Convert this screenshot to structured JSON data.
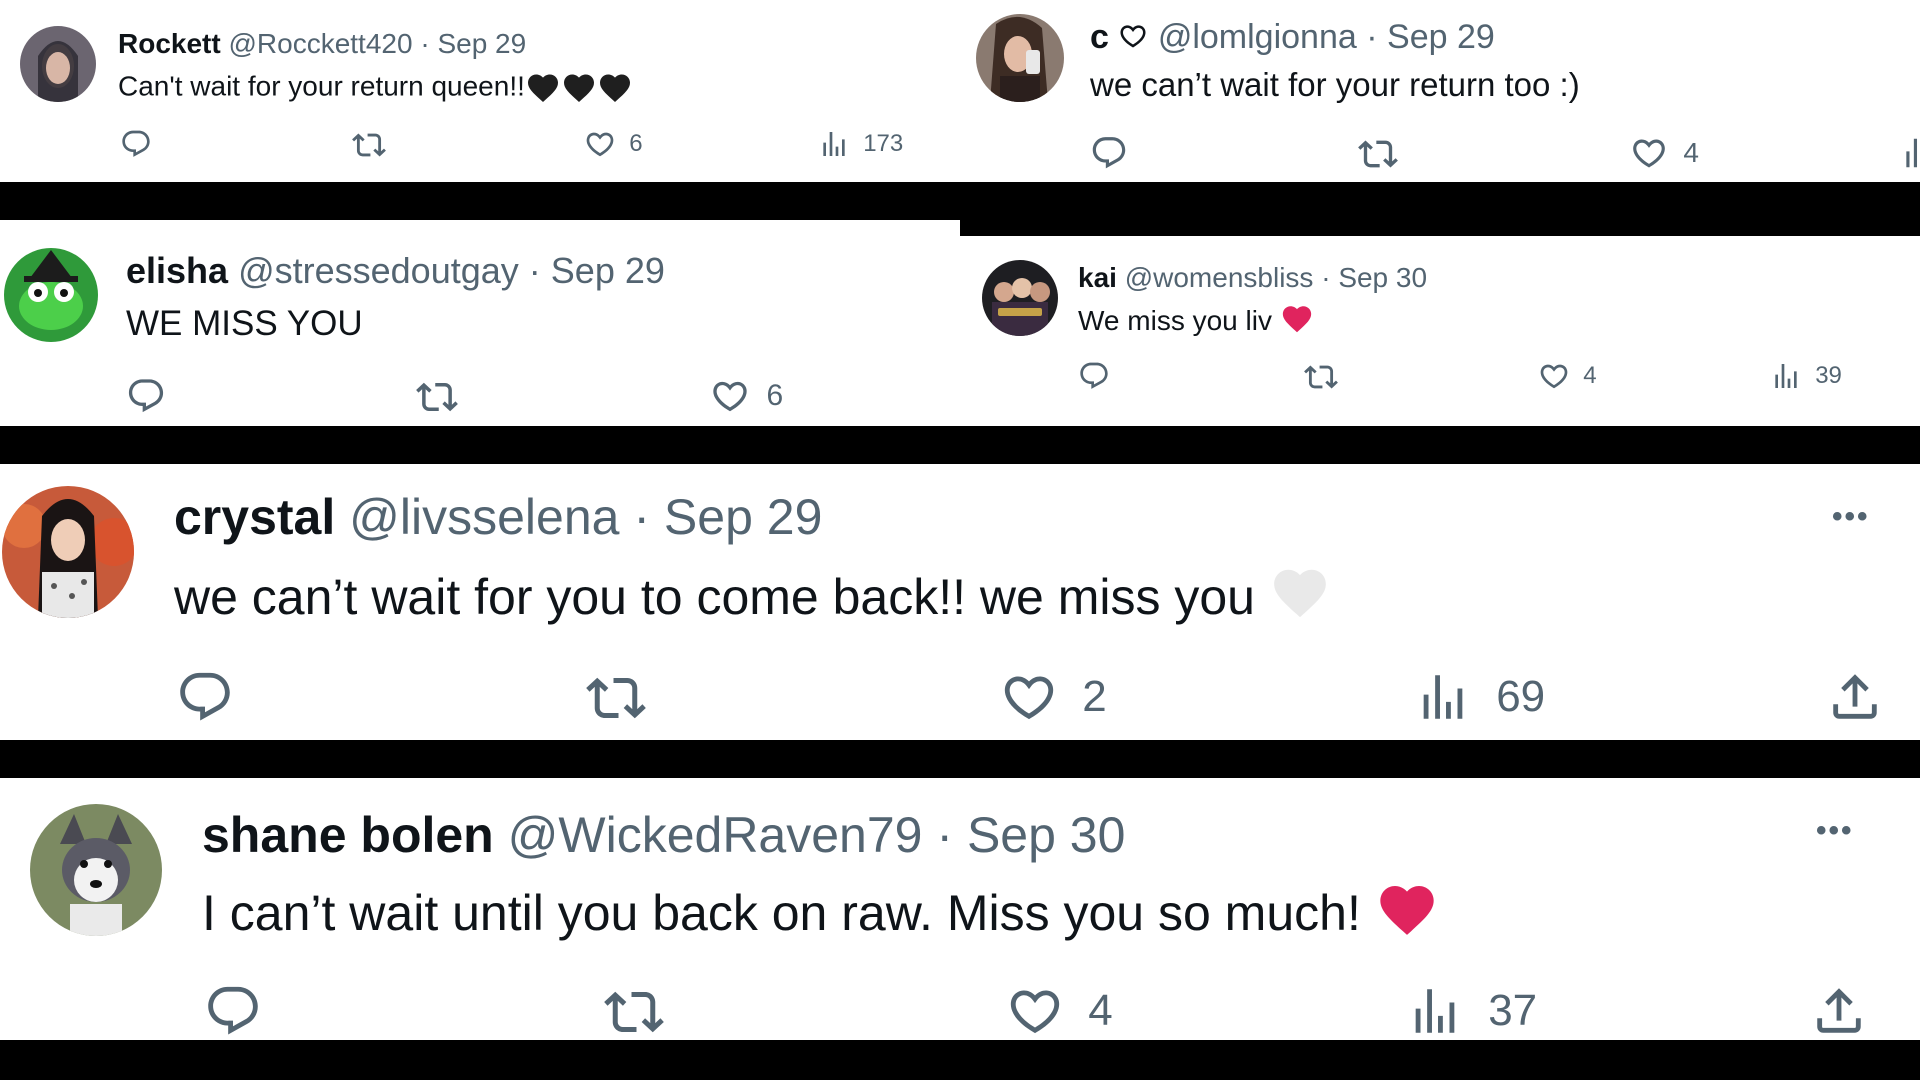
{
  "colors": {
    "divider": "#000000",
    "card_bg": "#ffffff",
    "text_primary": "#0f1419",
    "text_secondary": "#536471",
    "red_heart": "#e0245e",
    "black_heart": "#1f1f1f",
    "white_heart": "#e9e9e9"
  },
  "tweets": [
    {
      "name": "Rockett",
      "handle": "@Rocckett420",
      "sep": "·",
      "date": "Sep 29",
      "text": "Can't wait for your return queen!!",
      "emoji": "black-heart x3",
      "likes": "6",
      "views": "173",
      "avatar_icon": "person-photo-avatar"
    },
    {
      "name": "c",
      "handle": "@lomlgionna",
      "sep": "·",
      "date": "Sep 29",
      "text": "we can’t wait for your return too :)",
      "likes": "4",
      "avatar_icon": "selfie-avatar"
    },
    {
      "name": "elisha",
      "handle": "@stressedoutgay",
      "sep": "·",
      "date": "Sep 29",
      "text": "WE MISS YOU",
      "likes": "6",
      "avatar_icon": "green-frog-witch-avatar"
    },
    {
      "name": "kai",
      "handle": "@womensbliss",
      "sep": "·",
      "date": "Sep 30",
      "text": "We miss you liv",
      "emoji": "red-heart",
      "likes": "4",
      "views": "39",
      "avatar_icon": "group-photo-avatar"
    },
    {
      "name": "crystal",
      "handle": "@livsselena",
      "sep": "·",
      "date": "Sep 29",
      "text": "we can’t wait for you to come back!! we miss you",
      "emoji": "white-heart",
      "likes": "2",
      "views": "69",
      "more": "•••",
      "avatar_icon": "person-photo-avatar"
    },
    {
      "name": "shane bolen",
      "handle": "@WickedRaven79",
      "sep": "·",
      "date": "Sep 30",
      "text": "I can’t wait until you back on raw. Miss you so much!",
      "emoji": "red-heart",
      "likes": "4",
      "views": "37",
      "more": "•••",
      "avatar_icon": "husky-dog-avatar"
    }
  ]
}
